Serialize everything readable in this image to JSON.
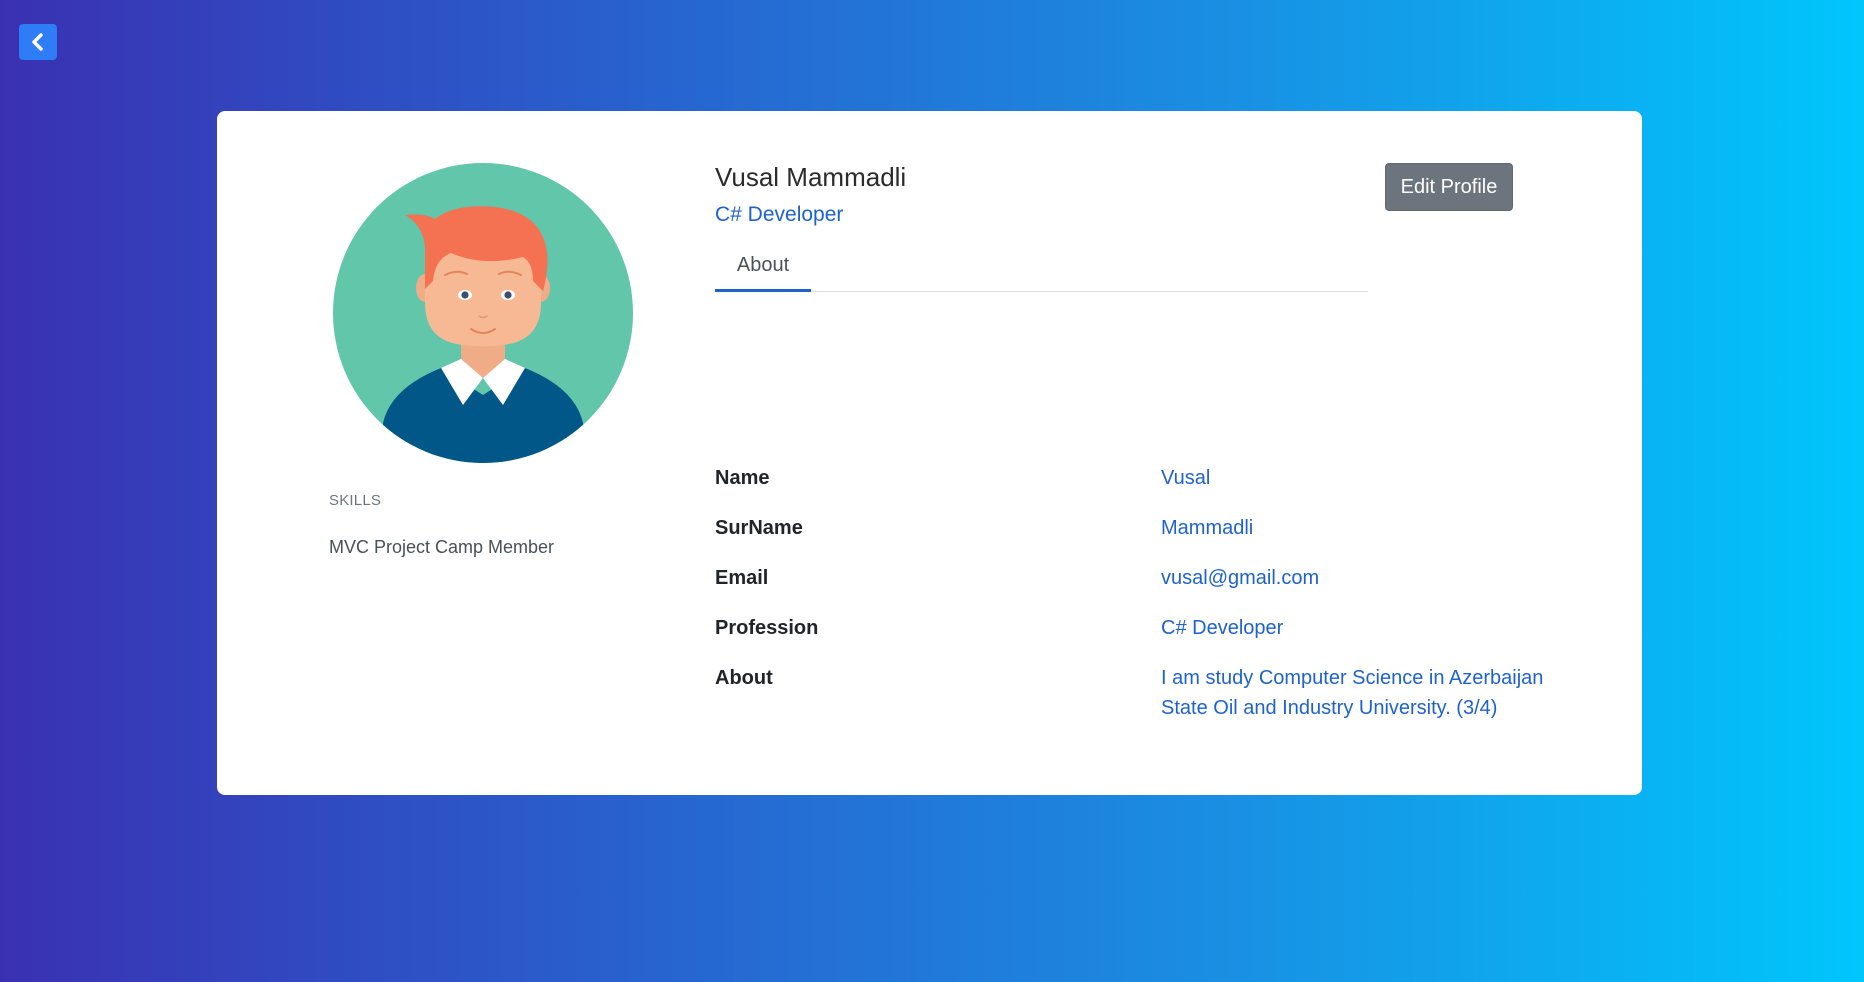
{
  "profile": {
    "name": "Vusal Mammadli",
    "title": "C# Developer",
    "edit_button_label": "Edit Profile"
  },
  "tabs": [
    {
      "label": "About",
      "active": true
    }
  ],
  "skills": {
    "heading": "SKILLS",
    "items": [
      "MVC Project Camp Member"
    ]
  },
  "about_fields": [
    {
      "label": "Name",
      "value": "Vusal"
    },
    {
      "label": "SurName",
      "value": "Mammadli"
    },
    {
      "label": "Email",
      "value": "vusal@gmail.com"
    },
    {
      "label": "Profession",
      "value": "C# Developer"
    },
    {
      "label": "About",
      "value": "I am study Computer Science in Azerbaijan State Oil and Industry University. (3/4)"
    }
  ],
  "icons": {
    "back": "chevron-left-icon",
    "avatar": "user-avatar-illustration"
  },
  "colors": {
    "accent": "#1e62d0",
    "back_button": "#2e7cf6",
    "edit_button": "#6c757d",
    "avatar_background": "#62c6aa",
    "gradient_start": "#3a31b2",
    "gradient_end": "#00c6fc"
  }
}
